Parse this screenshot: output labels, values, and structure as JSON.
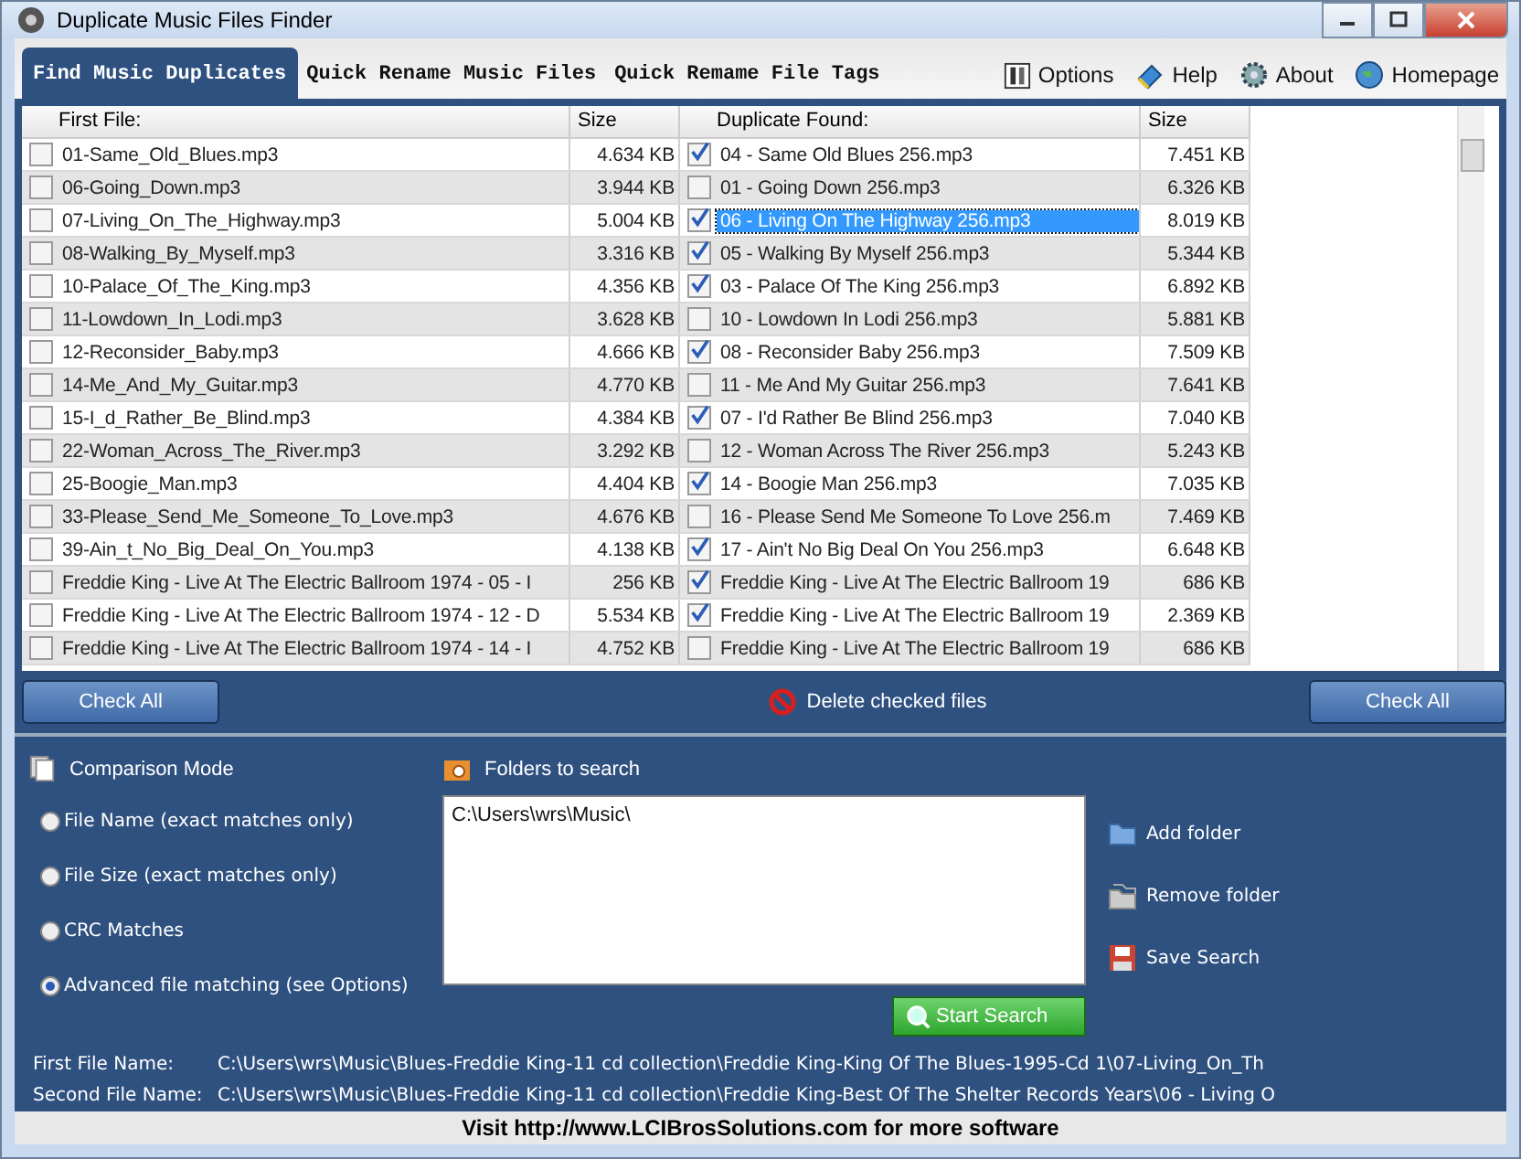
{
  "window": {
    "title": "Duplicate Music Files Finder"
  },
  "tabs": [
    {
      "label": "Find Music Duplicates",
      "selected": true
    },
    {
      "label": "Quick Rename Music Files",
      "selected": false
    },
    {
      "label": "Quick Remame File Tags",
      "selected": false
    }
  ],
  "menu": [
    {
      "label": "Options",
      "kind": "options"
    },
    {
      "label": "Help",
      "kind": "help"
    },
    {
      "label": "About",
      "kind": "about"
    },
    {
      "label": "Homepage",
      "kind": "homepage"
    }
  ],
  "table": {
    "columns": [
      "First File:",
      "Size",
      "Duplicate Found:",
      "Size"
    ],
    "rows": [
      {
        "first": {
          "name": "01-Same_Old_Blues.mp3",
          "size": "4.634 KB",
          "checked": false
        },
        "duplicate": {
          "name": "04 - Same Old Blues 256.mp3",
          "size": "7.451 KB",
          "checked": true,
          "selected": false
        }
      },
      {
        "first": {
          "name": "06-Going_Down.mp3",
          "size": "3.944 KB",
          "checked": false
        },
        "duplicate": {
          "name": "01 - Going Down 256.mp3",
          "size": "6.326 KB",
          "checked": false,
          "selected": false
        }
      },
      {
        "first": {
          "name": "07-Living_On_The_Highway.mp3",
          "size": "5.004 KB",
          "checked": false
        },
        "duplicate": {
          "name": "06 - Living On The Highway 256.mp3",
          "size": "8.019 KB",
          "checked": true,
          "selected": true
        }
      },
      {
        "first": {
          "name": "08-Walking_By_Myself.mp3",
          "size": "3.316 KB",
          "checked": false
        },
        "duplicate": {
          "name": "05 - Walking By Myself 256.mp3",
          "size": "5.344 KB",
          "checked": true,
          "selected": false
        }
      },
      {
        "first": {
          "name": "10-Palace_Of_The_King.mp3",
          "size": "4.356 KB",
          "checked": false
        },
        "duplicate": {
          "name": "03 - Palace Of The King 256.mp3",
          "size": "6.892 KB",
          "checked": true,
          "selected": false
        }
      },
      {
        "first": {
          "name": "11-Lowdown_In_Lodi.mp3",
          "size": "3.628 KB",
          "checked": false
        },
        "duplicate": {
          "name": "10 - Lowdown In Lodi 256.mp3",
          "size": "5.881 KB",
          "checked": false,
          "selected": false
        }
      },
      {
        "first": {
          "name": "12-Reconsider_Baby.mp3",
          "size": "4.666 KB",
          "checked": false
        },
        "duplicate": {
          "name": "08 - Reconsider Baby 256.mp3",
          "size": "7.509 KB",
          "checked": true,
          "selected": false
        }
      },
      {
        "first": {
          "name": "14-Me_And_My_Guitar.mp3",
          "size": "4.770 KB",
          "checked": false
        },
        "duplicate": {
          "name": "11 - Me And My Guitar 256.mp3",
          "size": "7.641 KB",
          "checked": false,
          "selected": false
        }
      },
      {
        "first": {
          "name": "15-I_d_Rather_Be_Blind.mp3",
          "size": "4.384 KB",
          "checked": false
        },
        "duplicate": {
          "name": "07 - I'd Rather Be Blind 256.mp3",
          "size": "7.040 KB",
          "checked": true,
          "selected": false
        }
      },
      {
        "first": {
          "name": "22-Woman_Across_The_River.mp3",
          "size": "3.292 KB",
          "checked": false
        },
        "duplicate": {
          "name": "12 - Woman Across The River 256.mp3",
          "size": "5.243 KB",
          "checked": false,
          "selected": false
        }
      },
      {
        "first": {
          "name": "25-Boogie_Man.mp3",
          "size": "4.404 KB",
          "checked": false
        },
        "duplicate": {
          "name": "14 - Boogie Man 256.mp3",
          "size": "7.035 KB",
          "checked": true,
          "selected": false
        }
      },
      {
        "first": {
          "name": "33-Please_Send_Me_Someone_To_Love.mp3",
          "size": "4.676 KB",
          "checked": false
        },
        "duplicate": {
          "name": "16 - Please Send Me Someone To Love 256.m",
          "size": "7.469 KB",
          "checked": false,
          "selected": false
        }
      },
      {
        "first": {
          "name": "39-Ain_t_No_Big_Deal_On_You.mp3",
          "size": "4.138 KB",
          "checked": false
        },
        "duplicate": {
          "name": "17 - Ain't No Big Deal On You 256.mp3",
          "size": "6.648 KB",
          "checked": true,
          "selected": false
        }
      },
      {
        "first": {
          "name": "Freddie King - Live At The Electric Ballroom 1974 - 05 - I",
          "size": "256 KB",
          "checked": false
        },
        "duplicate": {
          "name": "Freddie King - Live At The Electric Ballroom 19",
          "size": "686 KB",
          "checked": true,
          "selected": false
        }
      },
      {
        "first": {
          "name": "Freddie King - Live At The Electric Ballroom 1974 - 12 - D",
          "size": "5.534 KB",
          "checked": false
        },
        "duplicate": {
          "name": "Freddie King - Live At The Electric Ballroom 19",
          "size": "2.369 KB",
          "checked": true,
          "selected": false
        }
      },
      {
        "first": {
          "name": "Freddie King - Live At The Electric Ballroom 1974 - 14 - I",
          "size": "4.752 KB",
          "checked": false
        },
        "duplicate": {
          "name": "Freddie King - Live At The Electric Ballroom 19",
          "size": "686 KB",
          "checked": false,
          "selected": false
        }
      }
    ]
  },
  "check_all_left": "Check All",
  "delete_button": "Delete checked files",
  "check_all_right": "Check All",
  "comparison": {
    "title": "Comparison Mode",
    "options": [
      {
        "label": "File Name (exact matches only)",
        "selected": false
      },
      {
        "label": "File Size (exact matches only)",
        "selected": false
      },
      {
        "label": "CRC Matches",
        "selected": false
      },
      {
        "label": "Advanced file matching (see Options)",
        "selected": true
      }
    ]
  },
  "folders": {
    "title": "Folders to search",
    "items": [
      "C:\\Users\\wrs\\Music\\"
    ]
  },
  "folder_actions": [
    {
      "label": "Add folder",
      "kind": "add"
    },
    {
      "label": "Remove folder",
      "kind": "remove"
    },
    {
      "label": "Save Search",
      "kind": "save"
    }
  ],
  "start_search": "Start Search",
  "file_info": [
    {
      "label": "First File Name:",
      "value": "C:\\Users\\wrs\\Music\\Blues-Freddie King-11 cd collection\\Freddie King-King Of The Blues-1995-Cd 1\\07-Living_On_Th"
    },
    {
      "label": "Second File Name:",
      "value": "C:\\Users\\wrs\\Music\\Blues-Freddie King-11 cd collection\\Freddie King-Best Of The Shelter Records Years\\06 - Living O"
    }
  ],
  "footer": "Visit http://www.LCIBrosSolutions.com for more software"
}
